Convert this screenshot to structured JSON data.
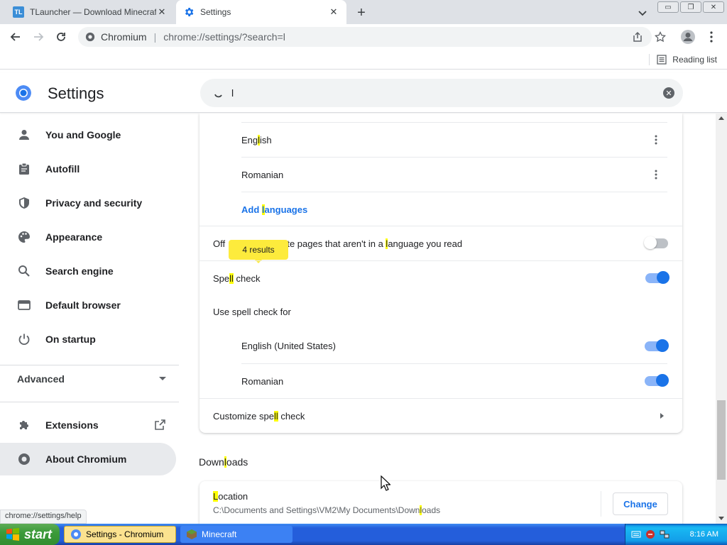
{
  "tabs": [
    {
      "title": "TLauncher — Download Minecraft L",
      "favicon": "tlauncher-logo",
      "favicon_text": "TL",
      "active": false
    },
    {
      "title": "Settings",
      "favicon": "settings-gear-icon",
      "active": true
    }
  ],
  "window_controls": {
    "minimize": "▭",
    "restore": "❐",
    "close": "✕"
  },
  "toolbar": {
    "site_chip": "Chromium",
    "url": "chrome://settings/?search=l"
  },
  "bookmarks": {
    "reading_list": "Reading list"
  },
  "settings": {
    "title": "Settings",
    "search_value": "l"
  },
  "sidebar": {
    "items": [
      {
        "label": "You and Google",
        "icon": "person-icon"
      },
      {
        "label": "Autofill",
        "icon": "clipboard-icon"
      },
      {
        "label": "Privacy and security",
        "icon": "shield-icon"
      },
      {
        "label": "Appearance",
        "icon": "palette-icon"
      },
      {
        "label": "Search engine",
        "icon": "search-icon"
      },
      {
        "label": "Default browser",
        "icon": "browser-icon"
      },
      {
        "label": "On startup",
        "icon": "power-icon"
      }
    ],
    "advanced": "Advanced",
    "extensions": "Extensions",
    "about": "About Chromium"
  },
  "main": {
    "languages": [
      {
        "pre": "Eng",
        "hl": "l",
        "post": "ish"
      },
      {
        "pre": "Romanian",
        "hl": "",
        "post": ""
      }
    ],
    "add_languages": {
      "pre": "Add ",
      "hl": "l",
      "post": "anguages"
    },
    "offer_translate": {
      "pre": "Offer to translate pages that aren't in a ",
      "hl": "l",
      "post": "anguage you read",
      "visible_prefix": "Off",
      "visible_rest": "ate pages that aren't in a ",
      "toggle_on": false
    },
    "results_bubble": "4 results",
    "spell_check": {
      "pre": "Spe",
      "hl": "ll",
      "post": " check",
      "toggle_on": true
    },
    "use_spell_check_for": "Use spell check for",
    "spell_languages": [
      {
        "label": "English (United States)",
        "toggle_on": true
      },
      {
        "label": "Romanian",
        "toggle_on": true
      }
    ],
    "customize_spell_check": {
      "pre": "Customize spe",
      "hl": "ll",
      "post": " check"
    },
    "downloads_title": {
      "pre": "Down",
      "hl": "l",
      "post": "oads"
    },
    "location": {
      "hl": "L",
      "post": "ocation"
    },
    "location_path": {
      "pre": "C:\\Documents and Settings\\VM2\\My Documents\\Down",
      "hl": "l",
      "post": "oads"
    },
    "change_button": "Change"
  },
  "status_url": "chrome://settings/help",
  "taskbar": {
    "start": "start",
    "tasks": [
      {
        "label": "Settings - Chromium",
        "active": true
      },
      {
        "label": "Minecraft",
        "active": false
      }
    ],
    "clock": "8:16 AM"
  },
  "colors": {
    "accent": "#1a73e8",
    "highlight": "#ffff00",
    "results_bubble": "#fdeb3c",
    "taskbar": "#245edb",
    "start": "#3c9b3a"
  }
}
